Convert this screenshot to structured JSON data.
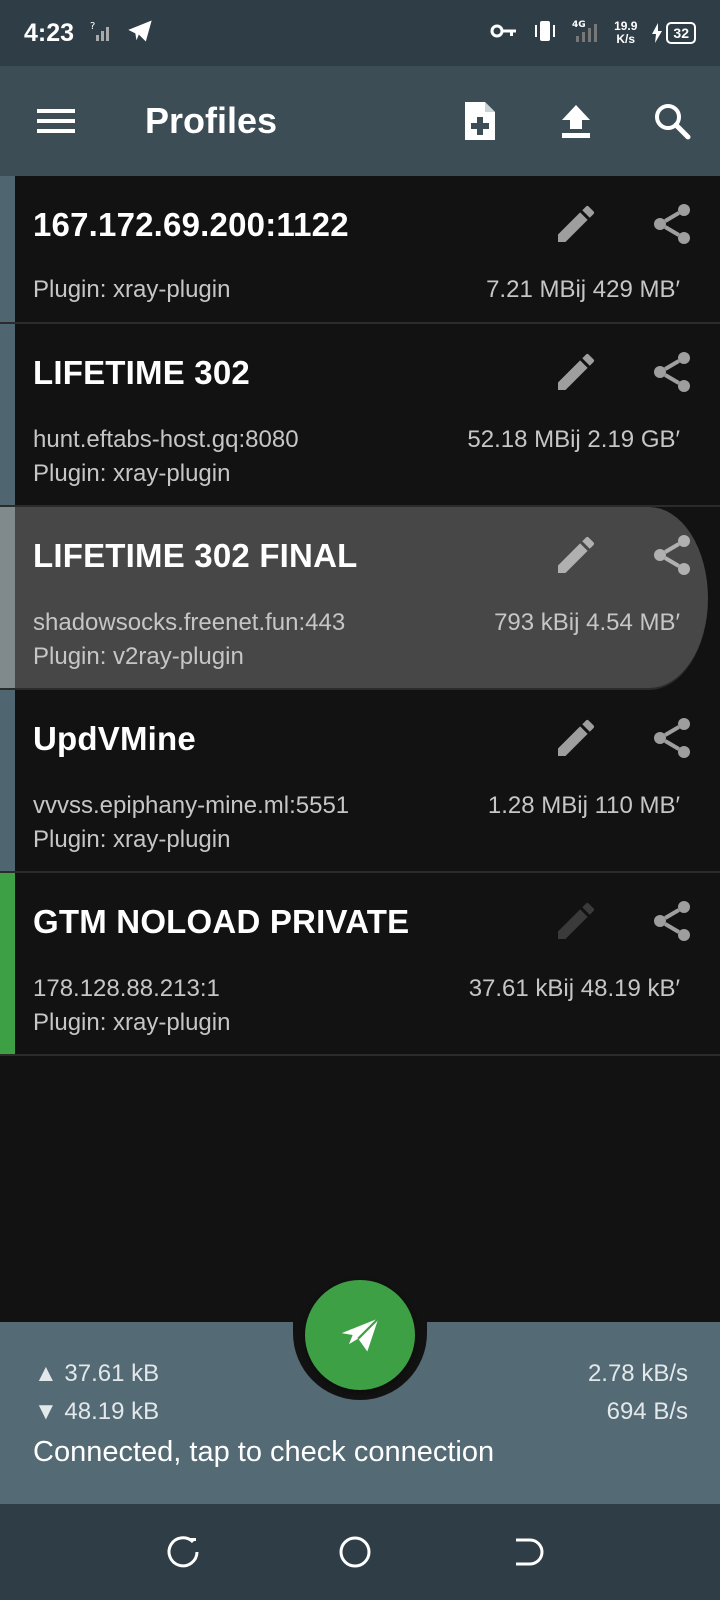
{
  "status_bar": {
    "time": "4:23",
    "net_speed_value": "19.9",
    "net_speed_unit": "K/s",
    "network_type": "4G",
    "battery": "32"
  },
  "app_bar": {
    "title": "Profiles"
  },
  "profiles": [
    {
      "title": "167.172.69.200:1122",
      "line1": "",
      "line2": "Plugin: xray-plugin",
      "stats": "7.21 MBij 429 MB′"
    },
    {
      "title": "LIFETIME 302",
      "line1": "hunt.eftabs-host.gq:8080",
      "line2": "Plugin: xray-plugin",
      "stats": "52.18 MBij 2.19 GB′"
    },
    {
      "title": "LIFETIME 302 FINAL",
      "line1": "shadowsocks.freenet.fun:443",
      "line2": "Plugin: v2ray-plugin",
      "stats": "793 kBij   4.54 MB′"
    },
    {
      "title": "UpdVMine",
      "line1": "vvvss.epiphany-mine.ml:5551",
      "line2": "Plugin: xray-plugin",
      "stats": "1.28 MBij 110 MB′"
    },
    {
      "title": "GTM NOLOAD PRIVATE",
      "line1": "178.128.88.213:1",
      "line2": "Plugin: xray-plugin",
      "stats": "37.61 kBij  48.19 kB′"
    }
  ],
  "stats_panel": {
    "tx_total": "▲ 37.61 kB",
    "rx_total": "▼ 48.19 kB",
    "tx_rate": "2.78 kB/s",
    "rx_rate": "694 B/s",
    "status": "Connected, tap to check connection"
  },
  "colors": {
    "connected": "#3ea044",
    "app_bar": "#3c4d56",
    "panel": "#546a75"
  }
}
